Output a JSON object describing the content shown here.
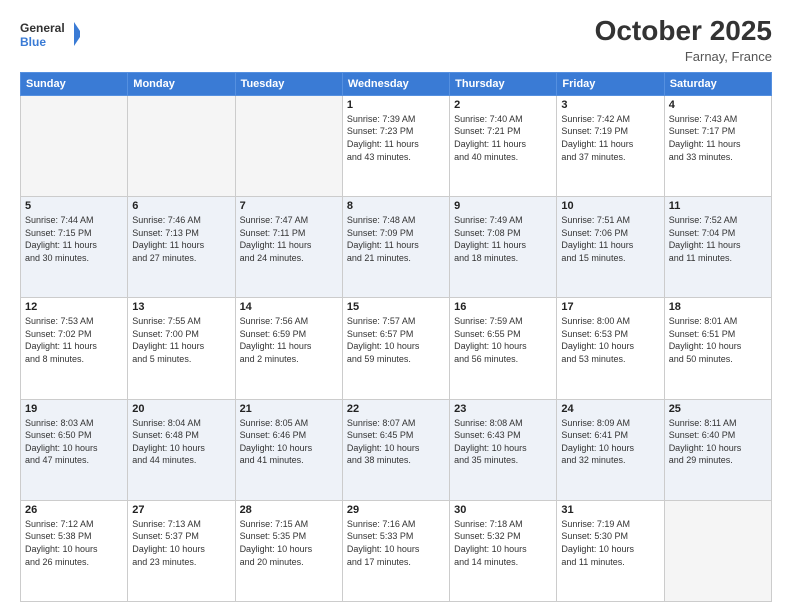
{
  "header": {
    "logo_line1": "General",
    "logo_line2": "Blue",
    "month_title": "October 2025",
    "location": "Farnay, France"
  },
  "weekdays": [
    "Sunday",
    "Monday",
    "Tuesday",
    "Wednesday",
    "Thursday",
    "Friday",
    "Saturday"
  ],
  "weeks": [
    {
      "alt": false,
      "days": [
        {
          "num": "",
          "info": ""
        },
        {
          "num": "",
          "info": ""
        },
        {
          "num": "",
          "info": ""
        },
        {
          "num": "1",
          "info": "Sunrise: 7:39 AM\nSunset: 7:23 PM\nDaylight: 11 hours\nand 43 minutes."
        },
        {
          "num": "2",
          "info": "Sunrise: 7:40 AM\nSunset: 7:21 PM\nDaylight: 11 hours\nand 40 minutes."
        },
        {
          "num": "3",
          "info": "Sunrise: 7:42 AM\nSunset: 7:19 PM\nDaylight: 11 hours\nand 37 minutes."
        },
        {
          "num": "4",
          "info": "Sunrise: 7:43 AM\nSunset: 7:17 PM\nDaylight: 11 hours\nand 33 minutes."
        }
      ]
    },
    {
      "alt": true,
      "days": [
        {
          "num": "5",
          "info": "Sunrise: 7:44 AM\nSunset: 7:15 PM\nDaylight: 11 hours\nand 30 minutes."
        },
        {
          "num": "6",
          "info": "Sunrise: 7:46 AM\nSunset: 7:13 PM\nDaylight: 11 hours\nand 27 minutes."
        },
        {
          "num": "7",
          "info": "Sunrise: 7:47 AM\nSunset: 7:11 PM\nDaylight: 11 hours\nand 24 minutes."
        },
        {
          "num": "8",
          "info": "Sunrise: 7:48 AM\nSunset: 7:09 PM\nDaylight: 11 hours\nand 21 minutes."
        },
        {
          "num": "9",
          "info": "Sunrise: 7:49 AM\nSunset: 7:08 PM\nDaylight: 11 hours\nand 18 minutes."
        },
        {
          "num": "10",
          "info": "Sunrise: 7:51 AM\nSunset: 7:06 PM\nDaylight: 11 hours\nand 15 minutes."
        },
        {
          "num": "11",
          "info": "Sunrise: 7:52 AM\nSunset: 7:04 PM\nDaylight: 11 hours\nand 11 minutes."
        }
      ]
    },
    {
      "alt": false,
      "days": [
        {
          "num": "12",
          "info": "Sunrise: 7:53 AM\nSunset: 7:02 PM\nDaylight: 11 hours\nand 8 minutes."
        },
        {
          "num": "13",
          "info": "Sunrise: 7:55 AM\nSunset: 7:00 PM\nDaylight: 11 hours\nand 5 minutes."
        },
        {
          "num": "14",
          "info": "Sunrise: 7:56 AM\nSunset: 6:59 PM\nDaylight: 11 hours\nand 2 minutes."
        },
        {
          "num": "15",
          "info": "Sunrise: 7:57 AM\nSunset: 6:57 PM\nDaylight: 10 hours\nand 59 minutes."
        },
        {
          "num": "16",
          "info": "Sunrise: 7:59 AM\nSunset: 6:55 PM\nDaylight: 10 hours\nand 56 minutes."
        },
        {
          "num": "17",
          "info": "Sunrise: 8:00 AM\nSunset: 6:53 PM\nDaylight: 10 hours\nand 53 minutes."
        },
        {
          "num": "18",
          "info": "Sunrise: 8:01 AM\nSunset: 6:51 PM\nDaylight: 10 hours\nand 50 minutes."
        }
      ]
    },
    {
      "alt": true,
      "days": [
        {
          "num": "19",
          "info": "Sunrise: 8:03 AM\nSunset: 6:50 PM\nDaylight: 10 hours\nand 47 minutes."
        },
        {
          "num": "20",
          "info": "Sunrise: 8:04 AM\nSunset: 6:48 PM\nDaylight: 10 hours\nand 44 minutes."
        },
        {
          "num": "21",
          "info": "Sunrise: 8:05 AM\nSunset: 6:46 PM\nDaylight: 10 hours\nand 41 minutes."
        },
        {
          "num": "22",
          "info": "Sunrise: 8:07 AM\nSunset: 6:45 PM\nDaylight: 10 hours\nand 38 minutes."
        },
        {
          "num": "23",
          "info": "Sunrise: 8:08 AM\nSunset: 6:43 PM\nDaylight: 10 hours\nand 35 minutes."
        },
        {
          "num": "24",
          "info": "Sunrise: 8:09 AM\nSunset: 6:41 PM\nDaylight: 10 hours\nand 32 minutes."
        },
        {
          "num": "25",
          "info": "Sunrise: 8:11 AM\nSunset: 6:40 PM\nDaylight: 10 hours\nand 29 minutes."
        }
      ]
    },
    {
      "alt": false,
      "days": [
        {
          "num": "26",
          "info": "Sunrise: 7:12 AM\nSunset: 5:38 PM\nDaylight: 10 hours\nand 26 minutes."
        },
        {
          "num": "27",
          "info": "Sunrise: 7:13 AM\nSunset: 5:37 PM\nDaylight: 10 hours\nand 23 minutes."
        },
        {
          "num": "28",
          "info": "Sunrise: 7:15 AM\nSunset: 5:35 PM\nDaylight: 10 hours\nand 20 minutes."
        },
        {
          "num": "29",
          "info": "Sunrise: 7:16 AM\nSunset: 5:33 PM\nDaylight: 10 hours\nand 17 minutes."
        },
        {
          "num": "30",
          "info": "Sunrise: 7:18 AM\nSunset: 5:32 PM\nDaylight: 10 hours\nand 14 minutes."
        },
        {
          "num": "31",
          "info": "Sunrise: 7:19 AM\nSunset: 5:30 PM\nDaylight: 10 hours\nand 11 minutes."
        },
        {
          "num": "",
          "info": ""
        }
      ]
    }
  ]
}
